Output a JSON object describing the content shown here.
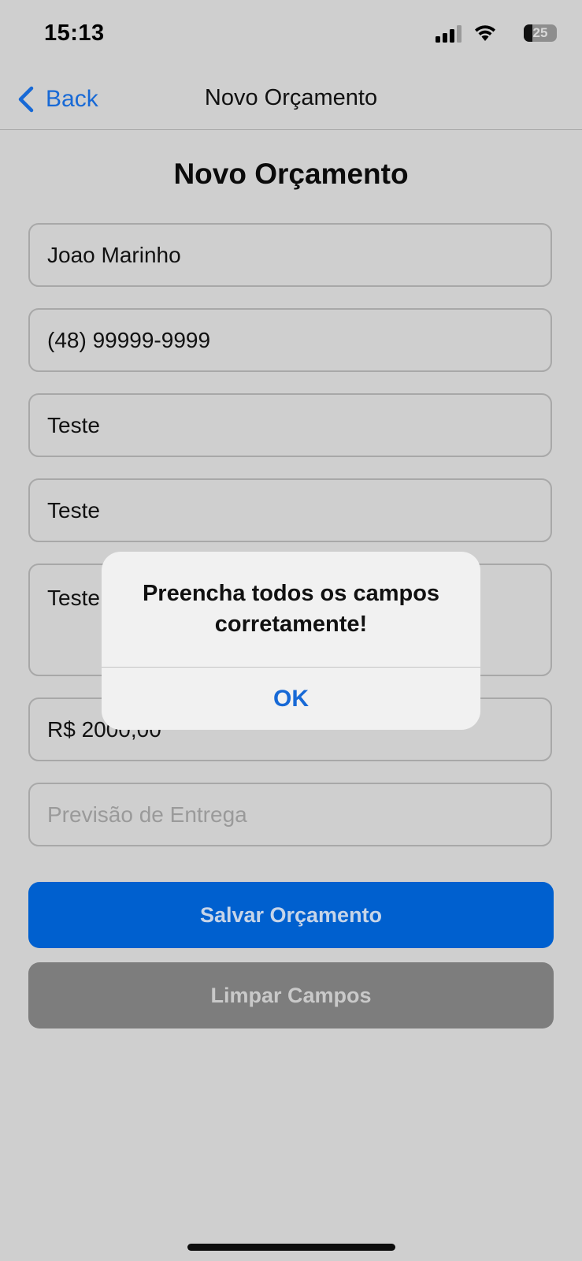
{
  "status_bar": {
    "time": "15:13",
    "battery_level": "25",
    "battery_fraction": 0.25,
    "icons": [
      "signal-icon",
      "wifi-icon",
      "battery-icon"
    ]
  },
  "nav": {
    "back_label": "Back",
    "title": "Novo Orçamento",
    "back_icon": "chevron-left-icon"
  },
  "form": {
    "title": "Novo Orçamento",
    "fields": [
      {
        "value": "Joao Marinho"
      },
      {
        "value": "(48) 99999-9999"
      },
      {
        "value": "Teste"
      },
      {
        "value": "Teste"
      },
      {
        "value": "Teste"
      },
      {
        "value": "R$ 2000,00"
      },
      {
        "value": "",
        "placeholder": "Previsão de Entrega"
      }
    ],
    "save_label": "Salvar Orçamento",
    "clear_label": "Limpar Campos"
  },
  "alert": {
    "message": "Preencha todos os campos corretamente!",
    "ok_label": "OK"
  },
  "colors": {
    "accent": "#1769d6",
    "save_button": "#0060cf",
    "clear_button": "#7d7d7d",
    "background": "#cfcfcf"
  }
}
